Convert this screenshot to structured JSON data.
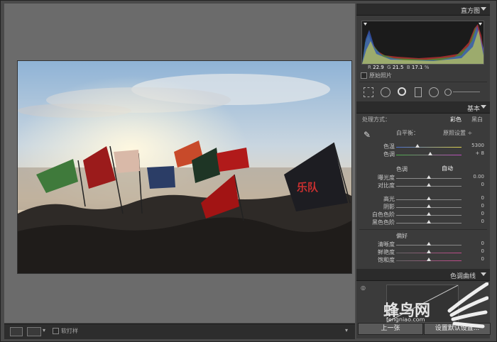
{
  "histogram": {
    "title": "直方图",
    "readout": {
      "r_label": "R",
      "r": "22.9",
      "g_label": "G",
      "g": "21.5",
      "b_label": "B",
      "b": "17.1",
      "unit": "%"
    },
    "original_photo_label": "原始照片"
  },
  "basic": {
    "title": "基本",
    "treatment_label": "处理方式：",
    "treatment_color": "彩色",
    "treatment_bw": "黑白",
    "wb_label": "白平衡：",
    "wb_value": "原照设置 ÷",
    "temp_label": "色温",
    "temp_value": "5300",
    "tint_label": "色调",
    "tint_value": "+ 8",
    "tone_section": "色调",
    "auto_label": "自动",
    "exposure_label": "曝光度",
    "exposure_value": "0.00",
    "contrast_label": "对比度",
    "contrast_value": "0",
    "highlights_label": "高光",
    "highlights_value": "0",
    "shadows_label": "阴影",
    "shadows_value": "0",
    "whites_label": "白色色阶",
    "whites_value": "0",
    "blacks_label": "黑色色阶",
    "blacks_value": "0",
    "presence_section": "偏好",
    "clarity_label": "清晰度",
    "clarity_value": "0",
    "vibrance_label": "鲜艳度",
    "vibrance_value": "0",
    "saturation_label": "饱和度",
    "saturation_value": "0"
  },
  "tone_curve": {
    "title": "色调曲线"
  },
  "buttons": {
    "previous": "上一张",
    "reset": "设置默认设置..."
  },
  "toolbar": {
    "soft_proof_label": "软打样"
  },
  "watermark": {
    "brand": "蜂鸟网",
    "url": "fengniao.com"
  },
  "colors": {
    "panel": "#3b3b3b",
    "header": "#2b2b2b",
    "background": "#6b6b6b"
  }
}
